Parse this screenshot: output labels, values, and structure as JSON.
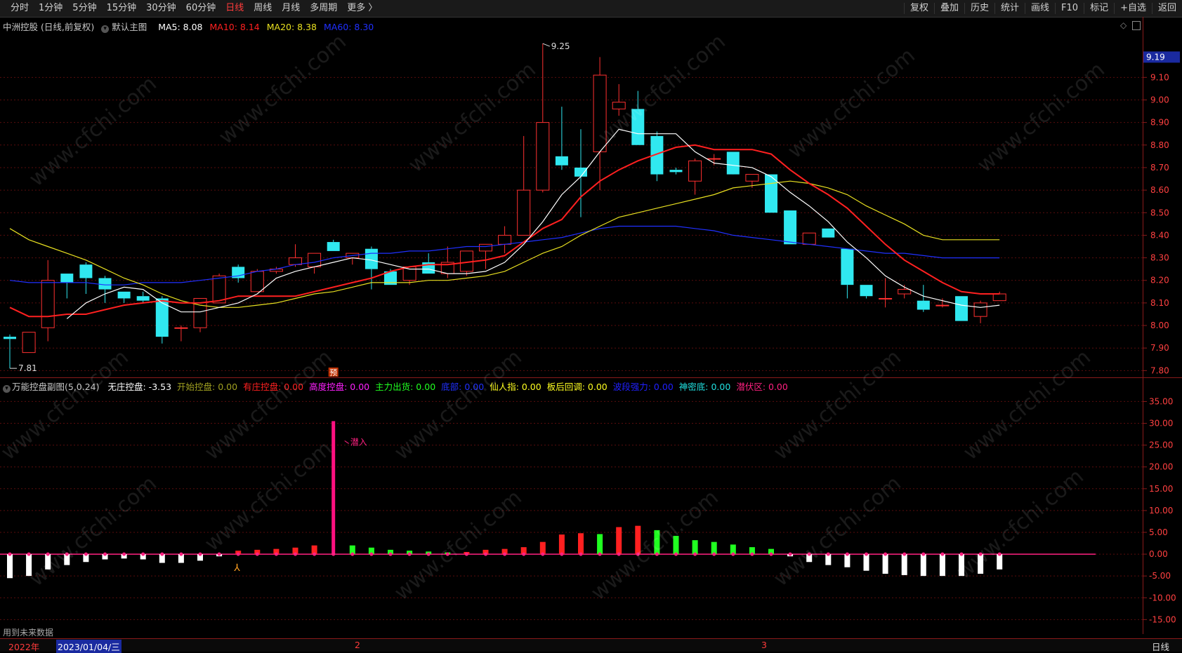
{
  "toolbar": {
    "left": [
      "分时",
      "1分钟",
      "5分钟",
      "15分钟",
      "30分钟",
      "60分钟",
      "日线",
      "周线",
      "月线",
      "多周期",
      "更多 〉"
    ],
    "active_index": 6,
    "right": [
      "复权",
      "叠加",
      "历史",
      "统计",
      "画线",
      "F10",
      "标记",
      "+自选",
      "返回"
    ]
  },
  "info": {
    "stock": "中洲控股 (日线,前复权)",
    "template": "默认主图",
    "ma5": "MA5: 8.08",
    "ma10": "MA10: 8.14",
    "ma20": "MA20: 8.38",
    "ma60": "MA60: 8.30",
    "colors": {
      "ma5": "#ffffff",
      "ma10": "#ff2020",
      "ma20": "#e8e020",
      "ma60": "#2030ff"
    }
  },
  "price_axis": {
    "current": "9.19",
    "ticks": [
      "9.10",
      "9.00",
      "8.90",
      "8.80",
      "8.70",
      "8.60",
      "8.50",
      "8.40",
      "8.30",
      "8.20",
      "8.10",
      "8.00",
      "7.90",
      "7.80"
    ]
  },
  "annotations": {
    "high": "9.25",
    "low": "7.81",
    "yu": "预",
    "qianru": "潜入"
  },
  "sub": {
    "name": "万能控盘副图(5,0.24)",
    "items": [
      {
        "label": "无庄控盘: -3.53",
        "color": "#ffffff"
      },
      {
        "label": "开始控盘: 0.00",
        "color": "#a0a020"
      },
      {
        "label": "有庄控盘: 0.00",
        "color": "#ff2020"
      },
      {
        "label": "高度控盘: 0.00",
        "color": "#ff20ff"
      },
      {
        "label": "主力出货: 0.00",
        "color": "#20ff20"
      },
      {
        "label": "底部: 0.00",
        "color": "#2030ff"
      },
      {
        "label": "仙人指: 0.00",
        "color": "#ffff20"
      },
      {
        "label": "板后回调: 0.00",
        "color": "#ffff20"
      },
      {
        "label": "波段强力: 0.00",
        "color": "#2020ff"
      },
      {
        "label": "神密底: 0.00",
        "color": "#20e0e0"
      },
      {
        "label": "潜伏区: 0.00",
        "color": "#ff2080"
      }
    ],
    "ticks": [
      "35.00",
      "30.00",
      "25.00",
      "20.00",
      "15.00",
      "10.00",
      "5.00",
      "0.00",
      "-5.00",
      "-10.00",
      "-15.00"
    ]
  },
  "bottom": {
    "future_data": "用到未来数据",
    "year": "2022年",
    "date": "2023/01/04/三",
    "m2": "2",
    "m3": "3",
    "period": "日线"
  },
  "watermark": "www.cfchi.com",
  "chart_data": {
    "type": "candlestick",
    "candles": [
      [
        7.95,
        7.96,
        7.81,
        7.94
      ],
      [
        7.88,
        7.97,
        7.88,
        7.97
      ],
      [
        7.99,
        8.29,
        7.93,
        8.2
      ],
      [
        8.23,
        8.23,
        8.12,
        8.19
      ],
      [
        8.27,
        8.28,
        8.14,
        8.21
      ],
      [
        8.21,
        8.22,
        8.1,
        8.16
      ],
      [
        8.15,
        8.15,
        8.1,
        8.12
      ],
      [
        8.13,
        8.15,
        8.1,
        8.11
      ],
      [
        8.12,
        8.13,
        7.92,
        7.95
      ],
      [
        7.99,
        8.0,
        7.93,
        7.99
      ],
      [
        7.99,
        8.12,
        7.97,
        8.12
      ],
      [
        8.1,
        8.23,
        8.1,
        8.22
      ],
      [
        8.26,
        8.27,
        8.19,
        8.21
      ],
      [
        8.15,
        8.25,
        8.15,
        8.24
      ],
      [
        8.24,
        8.26,
        8.23,
        8.25
      ],
      [
        8.27,
        8.36,
        8.26,
        8.3
      ],
      [
        8.26,
        8.31,
        8.23,
        8.32
      ],
      [
        8.37,
        8.38,
        8.33,
        8.33
      ],
      [
        8.3,
        8.32,
        8.27,
        8.32
      ],
      [
        8.34,
        8.35,
        8.16,
        8.25
      ],
      [
        8.24,
        8.25,
        8.18,
        8.18
      ],
      [
        8.2,
        8.26,
        8.18,
        8.26
      ],
      [
        8.28,
        8.32,
        8.23,
        8.23
      ],
      [
        8.23,
        8.35,
        8.21,
        8.28
      ],
      [
        8.24,
        8.32,
        8.22,
        8.33
      ],
      [
        8.33,
        8.35,
        8.25,
        8.36
      ],
      [
        8.36,
        8.44,
        8.32,
        8.4
      ],
      [
        8.4,
        8.84,
        8.4,
        8.6
      ],
      [
        8.6,
        9.25,
        8.59,
        8.9
      ],
      [
        8.75,
        8.97,
        8.69,
        8.71
      ],
      [
        8.7,
        8.87,
        8.48,
        8.66
      ],
      [
        8.77,
        9.19,
        8.6,
        9.11
      ],
      [
        8.96,
        9.07,
        8.93,
        8.99
      ],
      [
        8.96,
        9.04,
        8.8,
        8.8
      ],
      [
        8.84,
        8.86,
        8.64,
        8.67
      ],
      [
        8.69,
        8.7,
        8.67,
        8.68
      ],
      [
        8.64,
        8.74,
        8.58,
        8.73
      ],
      [
        8.74,
        8.76,
        8.71,
        8.74
      ],
      [
        8.77,
        8.77,
        8.69,
        8.67
      ],
      [
        8.64,
        8.66,
        8.61,
        8.67
      ],
      [
        8.67,
        8.67,
        8.5,
        8.5
      ],
      [
        8.51,
        8.51,
        8.36,
        8.36
      ],
      [
        8.36,
        8.41,
        8.36,
        8.41
      ],
      [
        8.43,
        8.43,
        8.39,
        8.39
      ],
      [
        8.34,
        8.34,
        8.12,
        8.18
      ],
      [
        8.18,
        8.18,
        8.12,
        8.13
      ],
      [
        8.12,
        8.21,
        8.08,
        8.12
      ],
      [
        8.14,
        8.18,
        8.12,
        8.16
      ],
      [
        8.11,
        8.18,
        8.06,
        8.07
      ],
      [
        8.09,
        8.12,
        8.08,
        8.09
      ],
      [
        8.13,
        8.13,
        8.02,
        8.02
      ],
      [
        8.04,
        8.11,
        8.01,
        8.1
      ],
      [
        8.11,
        8.15,
        8.11,
        8.14
      ]
    ],
    "ma5": [
      null,
      null,
      null,
      8.03,
      8.1,
      8.14,
      8.17,
      8.16,
      8.1,
      8.06,
      8.06,
      8.08,
      8.1,
      8.14,
      8.21,
      8.24,
      8.26,
      8.28,
      8.3,
      8.29,
      8.27,
      8.25,
      8.25,
      8.23,
      8.23,
      8.24,
      8.28,
      8.36,
      8.46,
      8.58,
      8.66,
      8.77,
      8.87,
      8.85,
      8.85,
      8.85,
      8.77,
      8.72,
      8.71,
      8.7,
      8.66,
      8.59,
      8.53,
      8.46,
      8.37,
      8.3,
      8.22,
      8.17,
      8.13,
      8.11,
      8.09,
      8.08,
      8.09
    ],
    "ma10": [
      8.08,
      8.04,
      8.04,
      8.05,
      8.05,
      8.07,
      8.09,
      8.1,
      8.11,
      8.1,
      8.1,
      8.11,
      8.13,
      8.13,
      8.13,
      8.13,
      8.15,
      8.17,
      8.19,
      8.21,
      8.24,
      8.26,
      8.27,
      8.27,
      8.28,
      8.29,
      8.31,
      8.37,
      8.43,
      8.47,
      8.57,
      8.64,
      8.69,
      8.73,
      8.76,
      8.79,
      8.8,
      8.78,
      8.78,
      8.78,
      8.76,
      8.69,
      8.63,
      8.58,
      8.52,
      8.44,
      8.36,
      8.29,
      8.24,
      8.19,
      8.15,
      8.14,
      8.14
    ],
    "ma20": [
      8.43,
      8.38,
      8.35,
      8.32,
      8.29,
      8.25,
      8.21,
      8.18,
      8.14,
      8.11,
      8.09,
      8.08,
      8.08,
      8.09,
      8.1,
      8.12,
      8.14,
      8.15,
      8.17,
      8.19,
      8.19,
      8.19,
      8.2,
      8.2,
      8.21,
      8.22,
      8.24,
      8.28,
      8.32,
      8.35,
      8.4,
      8.44,
      8.48,
      8.5,
      8.52,
      8.54,
      8.56,
      8.58,
      8.61,
      8.62,
      8.63,
      8.64,
      8.63,
      8.61,
      8.58,
      8.53,
      8.49,
      8.45,
      8.4,
      8.38,
      8.38,
      8.38,
      8.38
    ],
    "ma60": [
      8.2,
      8.19,
      8.19,
      8.19,
      8.19,
      8.18,
      8.18,
      8.19,
      8.19,
      8.19,
      8.2,
      8.21,
      8.22,
      8.24,
      8.25,
      8.27,
      8.28,
      8.3,
      8.31,
      8.32,
      8.32,
      8.33,
      8.33,
      8.34,
      8.35,
      8.35,
      8.36,
      8.37,
      8.38,
      8.39,
      8.41,
      8.43,
      8.44,
      8.44,
      8.44,
      8.44,
      8.43,
      8.42,
      8.4,
      8.39,
      8.38,
      8.37,
      8.36,
      8.35,
      8.34,
      8.33,
      8.32,
      8.32,
      8.31,
      8.3,
      8.3,
      8.3,
      8.3
    ],
    "ylim": [
      7.77,
      9.3
    ],
    "sub_values": [
      -5.5,
      -5.0,
      -3.5,
      -2.5,
      -1.8,
      -1.2,
      -1.0,
      -1.2,
      -2.0,
      -2.0,
      -1.5,
      -0.5,
      0.8,
      1.0,
      1.2,
      1.5,
      2.0,
      30.5,
      2.0,
      1.5,
      1.0,
      0.8,
      0.6,
      0.4,
      0.5,
      1.0,
      1.2,
      1.6,
      2.8,
      4.5,
      4.8,
      4.6,
      6.2,
      6.5,
      5.5,
      4.2,
      3.2,
      2.8,
      2.2,
      1.6,
      1.2,
      -0.5,
      -1.8,
      -2.5,
      -3.0,
      -3.8,
      -4.5,
      -4.8,
      -5.0,
      -5.0,
      -5.0,
      -4.5,
      -3.5
    ],
    "sub_ylim": [
      -18,
      37
    ]
  }
}
